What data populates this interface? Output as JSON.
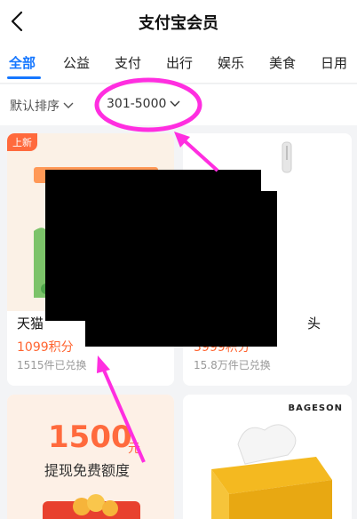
{
  "header": {
    "title": "支付宝会员"
  },
  "tabs": [
    {
      "label": "全部"
    },
    {
      "label": "公益"
    },
    {
      "label": "支付"
    },
    {
      "label": "出行"
    },
    {
      "label": "娱乐"
    },
    {
      "label": "美食"
    },
    {
      "label": "日用"
    }
  ],
  "filters": {
    "sort_label": "默认排序",
    "range_label": "301-5000"
  },
  "products": [
    {
      "badge": "上新",
      "name": "天猫",
      "price": "1099积分",
      "sold": "1515件已兑换"
    },
    {
      "name_suffix": "头",
      "price": "3999积分",
      "sold": "15.8万件已兑换"
    }
  ],
  "promo": {
    "amount": "1500",
    "unit": "元",
    "caption": "提现免费额度"
  },
  "brand_card": {
    "brand": "BAGESON"
  },
  "colors": {
    "accent": "#1677ff",
    "annotation": "#ff2ee0",
    "price": "#ff6430"
  }
}
